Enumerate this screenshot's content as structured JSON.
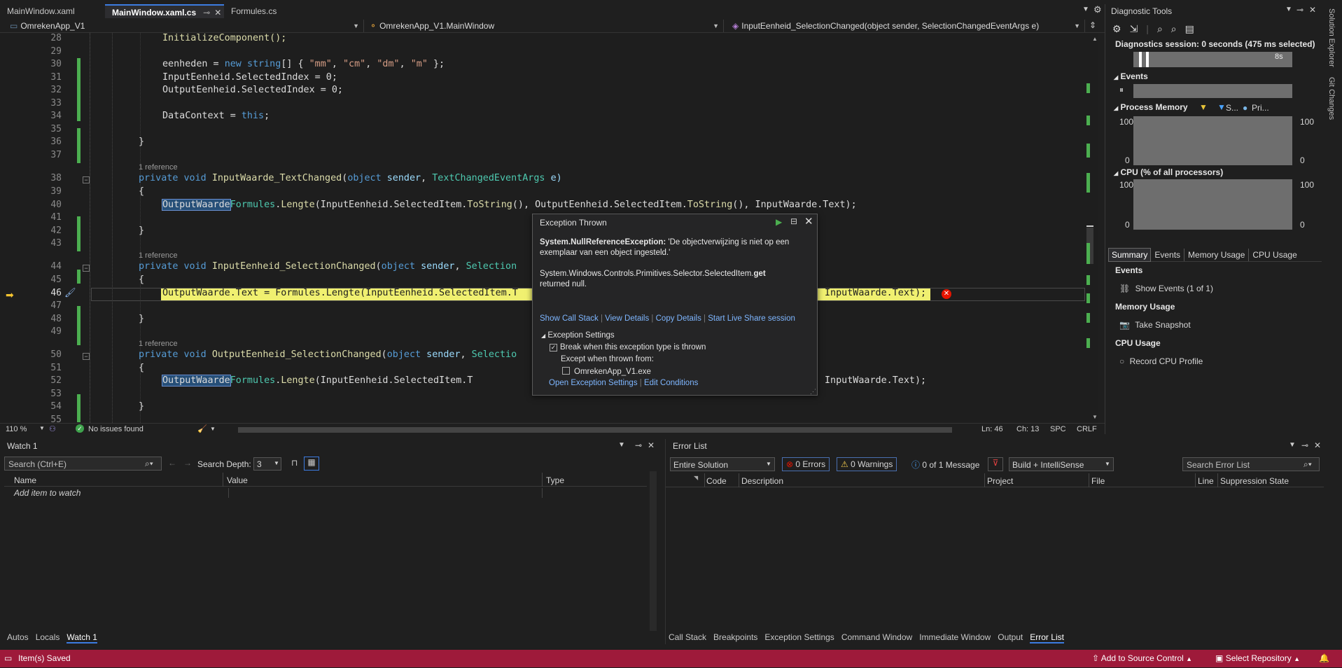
{
  "tabs": [
    {
      "label": "MainWindow.xaml"
    },
    {
      "label": "MainWindow.xaml.cs"
    },
    {
      "label": "Formules.cs"
    }
  ],
  "nav": {
    "project": "OmrekenApp_V1",
    "class": "OmrekenApp_V1.MainWindow",
    "member": "InputEenheid_SelectionChanged(object sender, SelectionChangedEventArgs e)"
  },
  "code": {
    "lines": [
      "28",
      "29",
      "30",
      "31",
      "32",
      "33",
      "34",
      "35",
      "36",
      "37",
      "38",
      "39",
      "40",
      "41",
      "42",
      "43",
      "44",
      "45",
      "46",
      "47",
      "48",
      "49",
      "50",
      "51",
      "52",
      "53",
      "54",
      "55"
    ],
    "ref_label": "1 reference",
    "l28": "InitializeComponent();",
    "l30a": "eenheden = ",
    "l30b": "new",
    "l30c": " ",
    "l30d": "string",
    "l30e": "[] { ",
    "l30f": "\"mm\"",
    "l30g": ", ",
    "l30h": "\"cm\"",
    "l30i": ", ",
    "l30j": "\"dm\"",
    "l30k": ", ",
    "l30l": "\"m\"",
    "l30m": " };",
    "l31": "InputEenheid.SelectedIndex = 0;",
    "l32": "OutputEenheid.SelectedIndex = 0;",
    "l34a": "DataContext = ",
    "l34b": "this",
    "l34c": ";",
    "brace_close": "}",
    "brace_open": "{",
    "private": "private",
    "void": "void",
    "object": "object",
    "sender": "sender",
    "m1": "InputWaarde_TextChanged",
    "m1b": "TextChangedEventArgs",
    "m1c": "e)",
    "outw": "OutputWaarde",
    ".text": ".Text = ",
    "formules": "Formules",
    "lengte": "Lengte",
    "l40rest1": "(InputEenheid.SelectedItem.",
    "tostring": "ToString",
    "l40rest2": "(), OutputEenheid.SelectedItem.",
    "l40rest3": "(), InputWaarde.Text);",
    "m2": "InputEenheid_SelectionChanged",
    "m2b": "Selection",
    "l46a": "OutputWaarde.Text = Formules.Lengte(InputEenheid.SelectedItem.T",
    "l46b": "InputWaarde.Text);",
    "m3": "OutputEenheid_SelectionChanged",
    "m3b": "Selectio",
    "l52a": "(InputEenheid.SelectedItem.T",
    "l52b": "InputWaarde.Text);"
  },
  "editor_status": {
    "zoom": "110 %",
    "issues": "No issues found",
    "ln": "Ln: 46",
    "ch": "Ch: 13",
    "spc": "SPC",
    "crlf": "CRLF"
  },
  "popup": {
    "title": "Exception Thrown",
    "exc_name": "System.NullReferenceException:",
    "exc_msg": " 'De objectverwijzing is niet op een exemplaar van een object ingesteld.'",
    "detail1": "System.Windows.Controls.Primitives.Selector.SelectedItem.",
    "detail_bold": "get",
    "detail2": "returned null.",
    "links": [
      "Show Call Stack",
      "View Details",
      "Copy Details",
      "Start Live Share session"
    ],
    "settings_label": "Exception Settings",
    "break_label": "Break when this exception type is thrown",
    "except_label": "Except when thrown from:",
    "exe_label": "OmrekenApp_V1.exe",
    "open_settings": "Open Exception Settings",
    "edit_conditions": "Edit Conditions"
  },
  "diag": {
    "title": "Diagnostic Tools",
    "session": "Diagnostics session: 0 seconds (475 ms selected)",
    "time_label": "8s",
    "events": "Events",
    "process_memory": "Process Memory",
    "legend_s": "S...",
    "legend_pri": "Pri...",
    "mem_max": "100",
    "mem_min": "0",
    "cpu": "CPU (% of all processors)",
    "cpu_max": "100",
    "cpu_min": "0",
    "tabs": [
      "Summary",
      "Events",
      "Memory Usage",
      "CPU Usage"
    ],
    "sec_events": "Events",
    "show_events": "Show Events (1 of 1)",
    "sec_memory": "Memory Usage",
    "take_snapshot": "Take Snapshot",
    "sec_cpu": "CPU Usage",
    "record_cpu": "Record CPU Profile",
    "side1": "Solution Explorer",
    "side2": "Git Changes"
  },
  "watch": {
    "title": "Watch 1",
    "search": "Search (Ctrl+E)",
    "depth_label": "Search Depth:",
    "depth": "3",
    "cols": [
      "Name",
      "Value",
      "Type"
    ],
    "add": "Add item to watch",
    "tabs": [
      "Autos",
      "Locals",
      "Watch 1"
    ]
  },
  "errors": {
    "title": "Error List",
    "scope": "Entire Solution",
    "errors": "0 Errors",
    "warnings": "0 Warnings",
    "messages": "0 of 1 Message",
    "build": "Build + IntelliSense",
    "search": "Search Error List",
    "cols": [
      "Code",
      "Description",
      "Project",
      "File",
      "Line",
      "Suppression State"
    ],
    "tabs": [
      "Call Stack",
      "Breakpoints",
      "Exception Settings",
      "Command Window",
      "Immediate Window",
      "Output",
      "Error List"
    ]
  },
  "status": {
    "saved": "Item(s) Saved",
    "source_control": "Add to Source Control",
    "repository": "Select Repository"
  },
  "colors": {
    "accent": "#3c7be0",
    "status_bar": "#9e1a3a",
    "change_bar": "#4caf50"
  }
}
